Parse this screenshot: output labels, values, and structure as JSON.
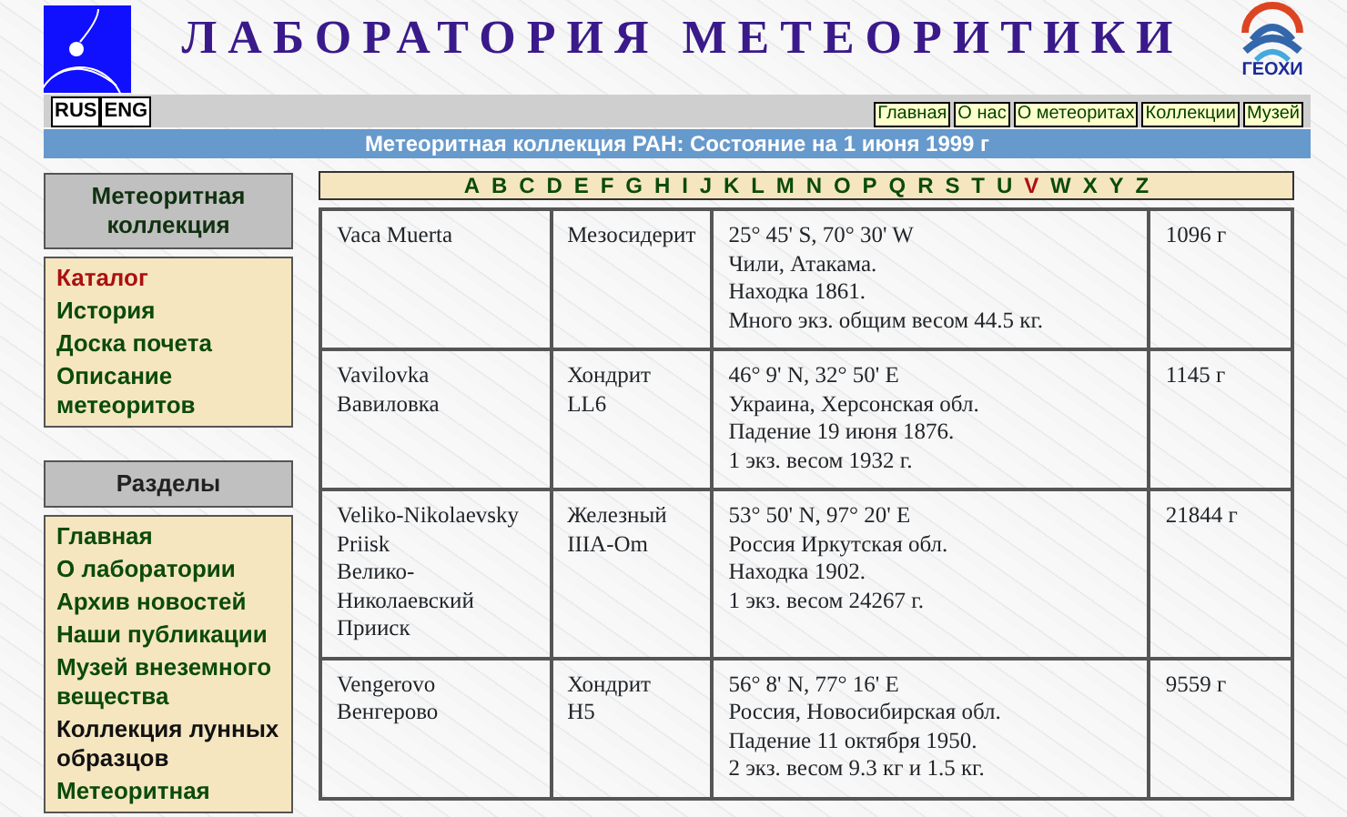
{
  "header": {
    "title": "ЛАБОРАТОРИЯ МЕТЕОРИТИКИ",
    "logo_text": "ГЕОХИ"
  },
  "languages": [
    "RUS",
    "ENG"
  ],
  "top_nav": [
    "Главная",
    "О нас",
    "О метеоритах",
    "Коллекции",
    "Музей"
  ],
  "banner": "Метеоритная коллекция РАН: Состояние на 1 июня 1999 г",
  "sidebar": [
    {
      "heading": "Метеоритная коллекция",
      "items": [
        {
          "label": "Каталог",
          "selected": true,
          "visited": false
        },
        {
          "label": "История",
          "selected": false,
          "visited": false
        },
        {
          "label": "Доска почета",
          "selected": false,
          "visited": false
        },
        {
          "label": "Описание метеоритов",
          "selected": false,
          "visited": false
        }
      ]
    },
    {
      "heading": "Разделы",
      "items": [
        {
          "label": "Главная",
          "selected": false,
          "visited": false
        },
        {
          "label": "О лаборатории",
          "selected": false,
          "visited": false
        },
        {
          "label": "Архив новостей",
          "selected": false,
          "visited": false
        },
        {
          "label": "Наши публикации",
          "selected": false,
          "visited": false
        },
        {
          "label": "Музей внеземного вещества",
          "selected": false,
          "visited": false
        },
        {
          "label": "Коллекция лунных образцов",
          "selected": false,
          "visited": true
        },
        {
          "label": "Метеоритная",
          "selected": false,
          "visited": false
        }
      ]
    }
  ],
  "letters": [
    {
      "label": "A",
      "selected": false
    },
    {
      "label": "B",
      "selected": false
    },
    {
      "label": "C",
      "selected": false
    },
    {
      "label": "D",
      "selected": false
    },
    {
      "label": "E",
      "selected": false
    },
    {
      "label": "F",
      "selected": false
    },
    {
      "label": "G",
      "selected": false
    },
    {
      "label": "H",
      "selected": false
    },
    {
      "label": "I",
      "selected": false
    },
    {
      "label": "J",
      "selected": false
    },
    {
      "label": "K",
      "selected": false
    },
    {
      "label": "L",
      "selected": false
    },
    {
      "label": "M",
      "selected": false
    },
    {
      "label": "N",
      "selected": false
    },
    {
      "label": "O",
      "selected": false
    },
    {
      "label": "P",
      "selected": false
    },
    {
      "label": "Q",
      "selected": false
    },
    {
      "label": "R",
      "selected": false
    },
    {
      "label": "S",
      "selected": false
    },
    {
      "label": "T",
      "selected": false
    },
    {
      "label": "U",
      "selected": false
    },
    {
      "label": "V",
      "selected": true
    },
    {
      "label": "W",
      "selected": false
    },
    {
      "label": "X",
      "selected": false
    },
    {
      "label": "Y",
      "selected": false
    },
    {
      "label": "Z",
      "selected": false
    }
  ],
  "table": {
    "rows": [
      {
        "name": "Vaca Muerta",
        "type": "Мезосидерит",
        "details": "25° 45' S, 70° 30' W\nЧили, Атакама.\nНаходка 1861.\nМного экз. общим весом 44.5 кг.",
        "mass": "1096 г"
      },
      {
        "name": "Vavilovka\nВавиловка",
        "type": "Хондрит\nLL6",
        "details": "46° 9' N, 32° 50' E\nУкраина, Херсонская обл.\nПадение 19 июня 1876.\n1 экз. весом 1932 г.",
        "mass": "1145 г"
      },
      {
        "name": "Veliko-Nikolaevsky\nPriisk\nВелико-\nНиколаевский\nПрииск",
        "type": "Железный\nIIIA-Om",
        "details": "53° 50' N, 97° 20' E\nРоссия Иркутская обл.\nНаходка 1902.\n1 экз. весом 24267 г.",
        "mass": "21844 г"
      },
      {
        "name": "Vengerovo\nВенгерово",
        "type": "Хондрит\nH5",
        "details": "56° 8' N, 77° 16' E\nРоссия, Новосибирская обл.\nПадение 11 октября 1950.\n2 экз. весом 9.3 кг и 1.5 кг.",
        "mass": "9559 г"
      }
    ]
  }
}
